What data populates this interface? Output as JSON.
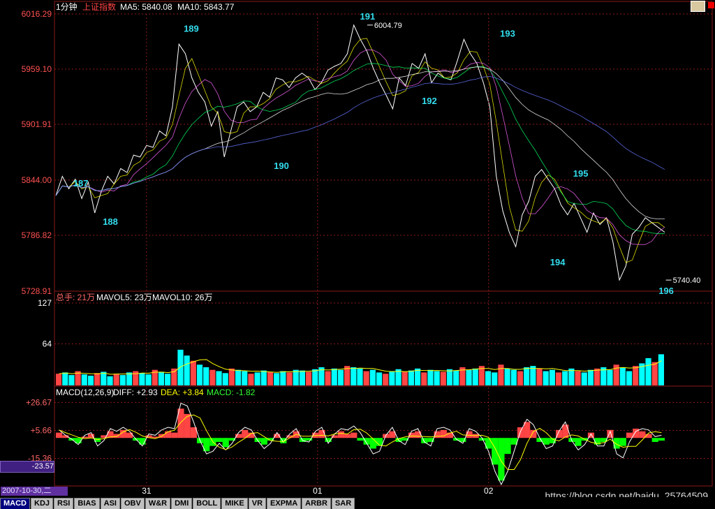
{
  "header": {
    "period": "1分钟",
    "index_name": "上证指数",
    "ma5_label": "MA5: 5840.08",
    "ma10_label": "MA10: 5843.77"
  },
  "volume_header": {
    "total": "总手: 21万",
    "mavol5": "MAVOL5: 23万",
    "mavol10": "MAVOL10: 26万"
  },
  "macd_header": {
    "title": "MACD(12,26,9)",
    "diff": "DIFF: +2.93",
    "dea": "DEA: +3.84",
    "macd": "MACD: -1.82"
  },
  "cursor_value": "-23.57",
  "date_label": "2007-10-30,二",
  "watermark": "https://blog.csdn.net/baidu_25764509",
  "tabs": [
    "MACD",
    "KDJ",
    "RSI",
    "BIAS",
    "ASI",
    "OBV",
    "W&R",
    "DMI",
    "BOLL",
    "MIKE",
    "VR",
    "EXPMA",
    "ARBR",
    "SAR"
  ],
  "active_tab": "MACD",
  "colors": {
    "background": "#000000",
    "grid": "#8b1a1a",
    "axis_text_price": "#ff5050",
    "label_cyan": "#33ddee",
    "volume_up": "#ff4444",
    "volume_down": "#00ffff",
    "macd_pos": "#ff4444",
    "macd_neg": "#00ff00"
  },
  "chart_data": [
    {
      "type": "line",
      "name": "price",
      "ylim": [
        5728.91,
        6016.29
      ],
      "y_ticks": [
        "6016.29",
        "5959.10",
        "5901.91",
        "5844.00",
        "5786.82",
        "5728.91"
      ],
      "wave_labels": [
        {
          "label": "187",
          "x": 0.04,
          "value": 5852
        },
        {
          "label": "188",
          "x": 0.085,
          "value": 5812
        },
        {
          "label": "189",
          "x": 0.208,
          "value": 5992
        },
        {
          "label": "190",
          "x": 0.345,
          "value": 5870
        },
        {
          "label": "191",
          "x": 0.476,
          "value": 6004.79
        },
        {
          "label": "192",
          "x": 0.57,
          "value": 5917
        },
        {
          "label": "193",
          "x": 0.689,
          "value": 5987
        },
        {
          "label": "194",
          "x": 0.765,
          "value": 5770
        },
        {
          "label": "195",
          "x": 0.8,
          "value": 5862
        },
        {
          "label": "196",
          "x": 0.93,
          "value": 5740.4
        }
      ],
      "annotations": [
        {
          "text": "6004.79",
          "x": 0.484,
          "value": 6004.79
        },
        {
          "text": "5740.40",
          "x": 0.938,
          "value": 5740.4
        }
      ],
      "x_ticks": [
        "31",
        "01",
        "02"
      ],
      "price_points": [
        5828,
        5848,
        5835,
        5845,
        5825,
        5842,
        5810,
        5832,
        5848,
        5840,
        5856,
        5852,
        5870,
        5868,
        5880,
        5878,
        5895,
        5890,
        5920,
        5985,
        5975,
        5950,
        5935,
        5925,
        5900,
        5915,
        5868,
        5895,
        5920,
        5925,
        5915,
        5920,
        5935,
        5930,
        5950,
        5948,
        5940,
        5950,
        5955,
        5950,
        5938,
        5945,
        5958,
        5962,
        5965,
        5975,
        6004.79,
        5990,
        5978,
        5960,
        5945,
        5932,
        5918,
        5950,
        5942,
        5965,
        5960,
        5975,
        5945,
        5955,
        5950,
        5948,
        5968,
        5990,
        5975,
        5965,
        5945,
        5920,
        5848,
        5812,
        5790,
        5775,
        5808,
        5822,
        5848,
        5855,
        5845,
        5835,
        5818,
        5808,
        5820,
        5805,
        5790,
        5810,
        5798,
        5805,
        5780,
        5740.4,
        5755,
        5788,
        5795,
        5805,
        5800,
        5795,
        5790
      ]
    },
    {
      "type": "bar",
      "name": "volume",
      "ylim": [
        0,
        127
      ],
      "y_ticks": [
        "127",
        "64"
      ],
      "values": [
        18,
        20,
        16,
        22,
        17,
        15,
        19,
        21,
        14,
        18,
        16,
        20,
        22,
        19,
        17,
        24,
        21,
        18,
        26,
        55,
        46,
        38,
        32,
        28,
        24,
        22,
        19,
        26,
        24,
        22,
        18,
        20,
        23,
        21,
        19,
        22,
        20,
        24,
        23,
        21,
        25,
        28,
        22,
        26,
        24,
        30,
        28,
        26,
        22,
        24,
        20,
        18,
        22,
        25,
        21,
        23,
        26,
        20,
        24,
        22,
        21,
        25,
        23,
        28,
        24,
        26,
        30,
        22,
        20,
        32,
        26,
        24,
        22,
        28,
        30,
        26,
        22,
        24,
        20,
        22,
        26,
        22,
        20,
        24,
        26,
        28,
        24,
        32,
        28,
        22,
        30,
        34,
        42,
        36,
        48
      ]
    },
    {
      "type": "bar",
      "name": "macd",
      "ylim": [
        -35,
        30
      ],
      "y_ticks": [
        "+26.67",
        "+5.66",
        "-15.36"
      ],
      "values": [
        4,
        2,
        -2,
        -4,
        1,
        3,
        -3,
        2,
        5,
        3,
        6,
        4,
        -2,
        -5,
        2,
        1,
        3,
        5,
        4,
        22,
        18,
        8,
        -4,
        -10,
        -6,
        -3,
        -7,
        -2,
        3,
        6,
        4,
        -3,
        -5,
        -2,
        3,
        -4,
        2,
        5,
        -3,
        -2,
        4,
        6,
        -3,
        2,
        5,
        3,
        4,
        -2,
        -5,
        -8,
        -6,
        3,
        5,
        -3,
        -2,
        4,
        5,
        -4,
        -3,
        5,
        6,
        4,
        -2,
        -3,
        5,
        3,
        -2,
        -8,
        -20,
        -32,
        -12,
        -5,
        8,
        12,
        6,
        -3,
        -5,
        -4,
        6,
        10,
        -3,
        -6,
        -2,
        4,
        -5,
        -3,
        6,
        -8,
        -6,
        4,
        7,
        5,
        3,
        -3,
        -2
      ],
      "diff_points": [
        6,
        2,
        -1,
        -5,
        2,
        4,
        -6,
        -2,
        7,
        5,
        8,
        5,
        -1,
        -6,
        3,
        2,
        6,
        8,
        7,
        26,
        24,
        12,
        -2,
        -12,
        -10,
        -4,
        -9,
        -4,
        4,
        8,
        6,
        -2,
        -8,
        -4,
        4,
        -3,
        3,
        7,
        -2,
        -3,
        5,
        8,
        -4,
        3,
        7,
        6,
        9,
        4,
        -4,
        -12,
        -10,
        2,
        8,
        -2,
        -5,
        5,
        7,
        -3,
        -6,
        7,
        8,
        6,
        -1,
        -4,
        7,
        5,
        0,
        -10,
        -25,
        -35,
        -25,
        -10,
        5,
        14,
        10,
        0,
        -8,
        -6,
        5,
        12,
        -2,
        -9,
        -5,
        3,
        -6,
        -6,
        5,
        -12,
        -15,
        -3,
        5,
        7,
        6,
        1,
        2
      ]
    }
  ]
}
